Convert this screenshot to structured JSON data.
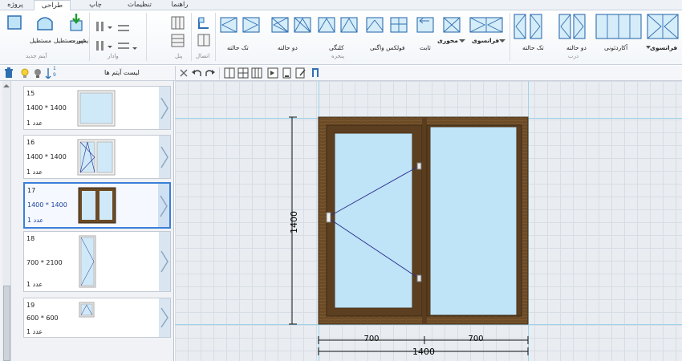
{
  "tabs": [
    {
      "label": "پروژه"
    },
    {
      "label": "طراحی",
      "active": true
    },
    {
      "label": "چاپ"
    },
    {
      "label": "تنظیمات"
    },
    {
      "label": "راهنما"
    }
  ],
  "ribbon": {
    "new_item": {
      "group_label": "آیتم جدید",
      "fixed_label": "مستطیل",
      "nonfixed_label": "غیر مستطیل",
      "import_label": "ایمپورت"
    },
    "vadar": {
      "group_label": "وادار"
    },
    "panel": {
      "group_label": "پنل"
    },
    "ettesal": {
      "group_label": "اتصال"
    },
    "window": {
      "group_label": "پنجره",
      "tak_halate": "تک حالته",
      "do_halate": "دو حالته",
      "kolangi": "کلنگی",
      "folex_vagi": "فولکس واگنی",
      "sabet": "ثابت",
      "mehvari": "محوری",
      "faransavi": "فرانسوی"
    },
    "door": {
      "group_label": "درب",
      "tak_halate": "تک حالته",
      "do_halate": "دو حالته",
      "akardeoni": "آکاردئونی",
      "faransavi": "فرانسوی"
    }
  },
  "items_list": {
    "title": "لیست آیتم ها",
    "sort_icon_text_top": "1",
    "sort_icon_text_bottom": "9",
    "items": [
      {
        "number": "15",
        "size": "1400 * 1400",
        "qty_value": "1",
        "qty_unit": "عدد",
        "selected": false
      },
      {
        "number": "16",
        "size": "1400 * 1400",
        "qty_value": "1",
        "qty_unit": "عدد",
        "selected": false
      },
      {
        "number": "17",
        "size": "1400 * 1400",
        "qty_value": "1",
        "qty_unit": "عدد",
        "selected": true
      },
      {
        "number": "18",
        "size": "700 * 2100",
        "qty_value": "1",
        "qty_unit": "عدد",
        "selected": false
      },
      {
        "number": "19",
        "size": "600 * 600",
        "qty_value": "1",
        "qty_unit": "عدد",
        "selected": false
      }
    ]
  },
  "design": {
    "height_dim": "1400",
    "left_sash_dim": "700",
    "right_sash_dim": "700",
    "total_width_dim": "1400"
  },
  "colors": {
    "frame_wood": "#6b4a26",
    "glass": "#bfe3f7",
    "selection": "#3b7fd9",
    "grid_guide": "#9ed2e8",
    "dimension_line": "#111111",
    "opening_line": "#2a2f8f"
  }
}
